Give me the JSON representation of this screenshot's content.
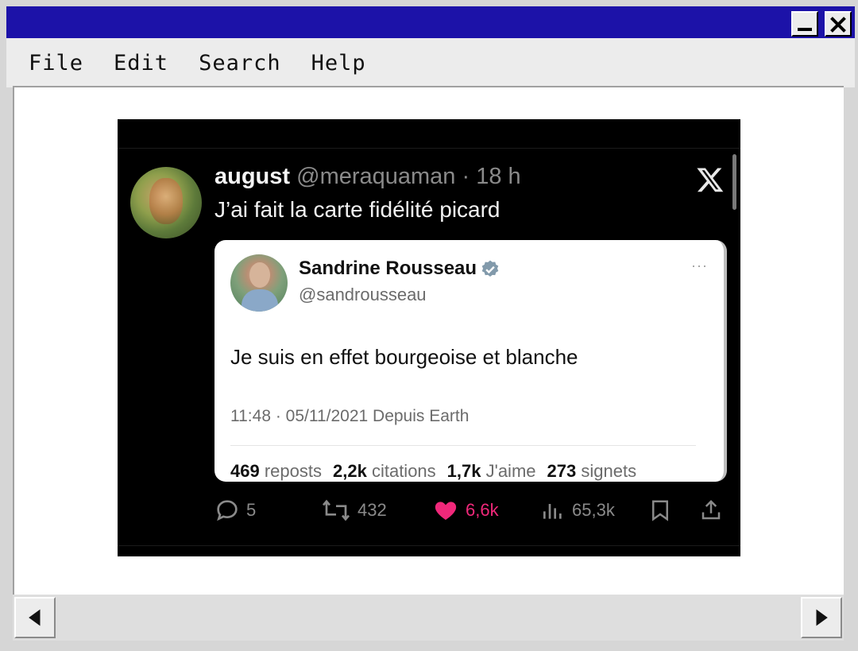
{
  "menu": {
    "items": [
      "File",
      "Edit",
      "Search",
      "Help"
    ]
  },
  "tweet": {
    "author_name": "august",
    "author_handle": "@meraquaman",
    "time_ago": "· 18 h",
    "text": "J’ai fait la carte fidélité picard",
    "quote": {
      "name": "Sandrine Rousseau",
      "handle": "@sandrousseau",
      "more": "···",
      "text": "Je suis en effet bourgeoise et blanche",
      "timestamp": "11:48 · 05/11/2021 Depuis Earth",
      "stats": [
        {
          "value": "469",
          "label": "reposts"
        },
        {
          "value": "2,2k",
          "label": "citations"
        },
        {
          "value": "1,7k",
          "label": "J'aime"
        },
        {
          "value": "273",
          "label": "signets"
        }
      ]
    },
    "actions": {
      "replies": "5",
      "reposts": "432",
      "likes": "6,6k",
      "views": "65,3k"
    }
  },
  "colors": {
    "titlebar": "#1c12a8",
    "like": "#f0287a",
    "verified": "#829aab"
  },
  "icons": [
    "minimize-icon",
    "close-icon",
    "x-logo-icon",
    "verified-badge-icon",
    "reply-icon",
    "repost-icon",
    "like-icon",
    "views-icon",
    "bookmark-icon",
    "share-icon",
    "arrow-left-icon",
    "arrow-right-icon"
  ]
}
